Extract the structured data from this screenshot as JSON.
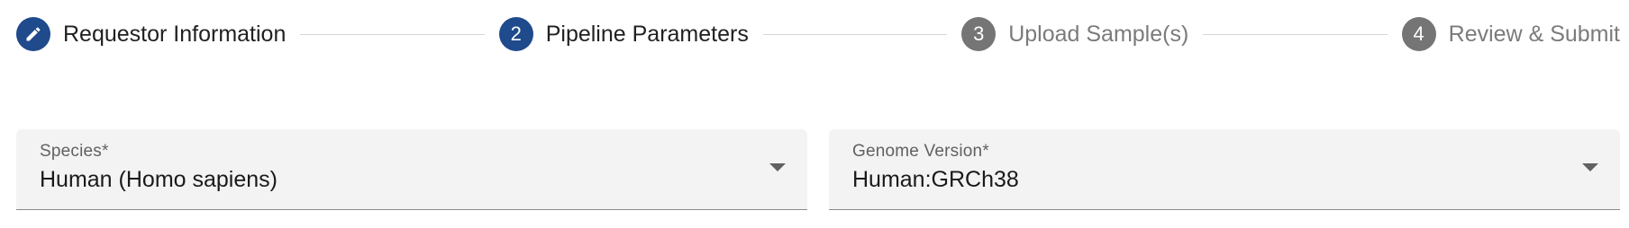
{
  "stepper": {
    "steps": [
      {
        "number": "",
        "icon": "pencil-icon",
        "label": "Requestor Information",
        "state": "completed"
      },
      {
        "number": "2",
        "label": "Pipeline Parameters",
        "state": "active"
      },
      {
        "number": "3",
        "label": "Upload Sample(s)",
        "state": "inactive"
      },
      {
        "number": "4",
        "label": "Review & Submit",
        "state": "inactive"
      }
    ]
  },
  "form": {
    "species": {
      "label": "Species*",
      "value": "Human (Homo sapiens)"
    },
    "genome_version": {
      "label": "Genome Version*",
      "value": "Human:GRCh38"
    }
  },
  "colors": {
    "active_step": "#1f4a8c",
    "inactive_step": "#757575",
    "field_background": "#f3f3f3"
  }
}
